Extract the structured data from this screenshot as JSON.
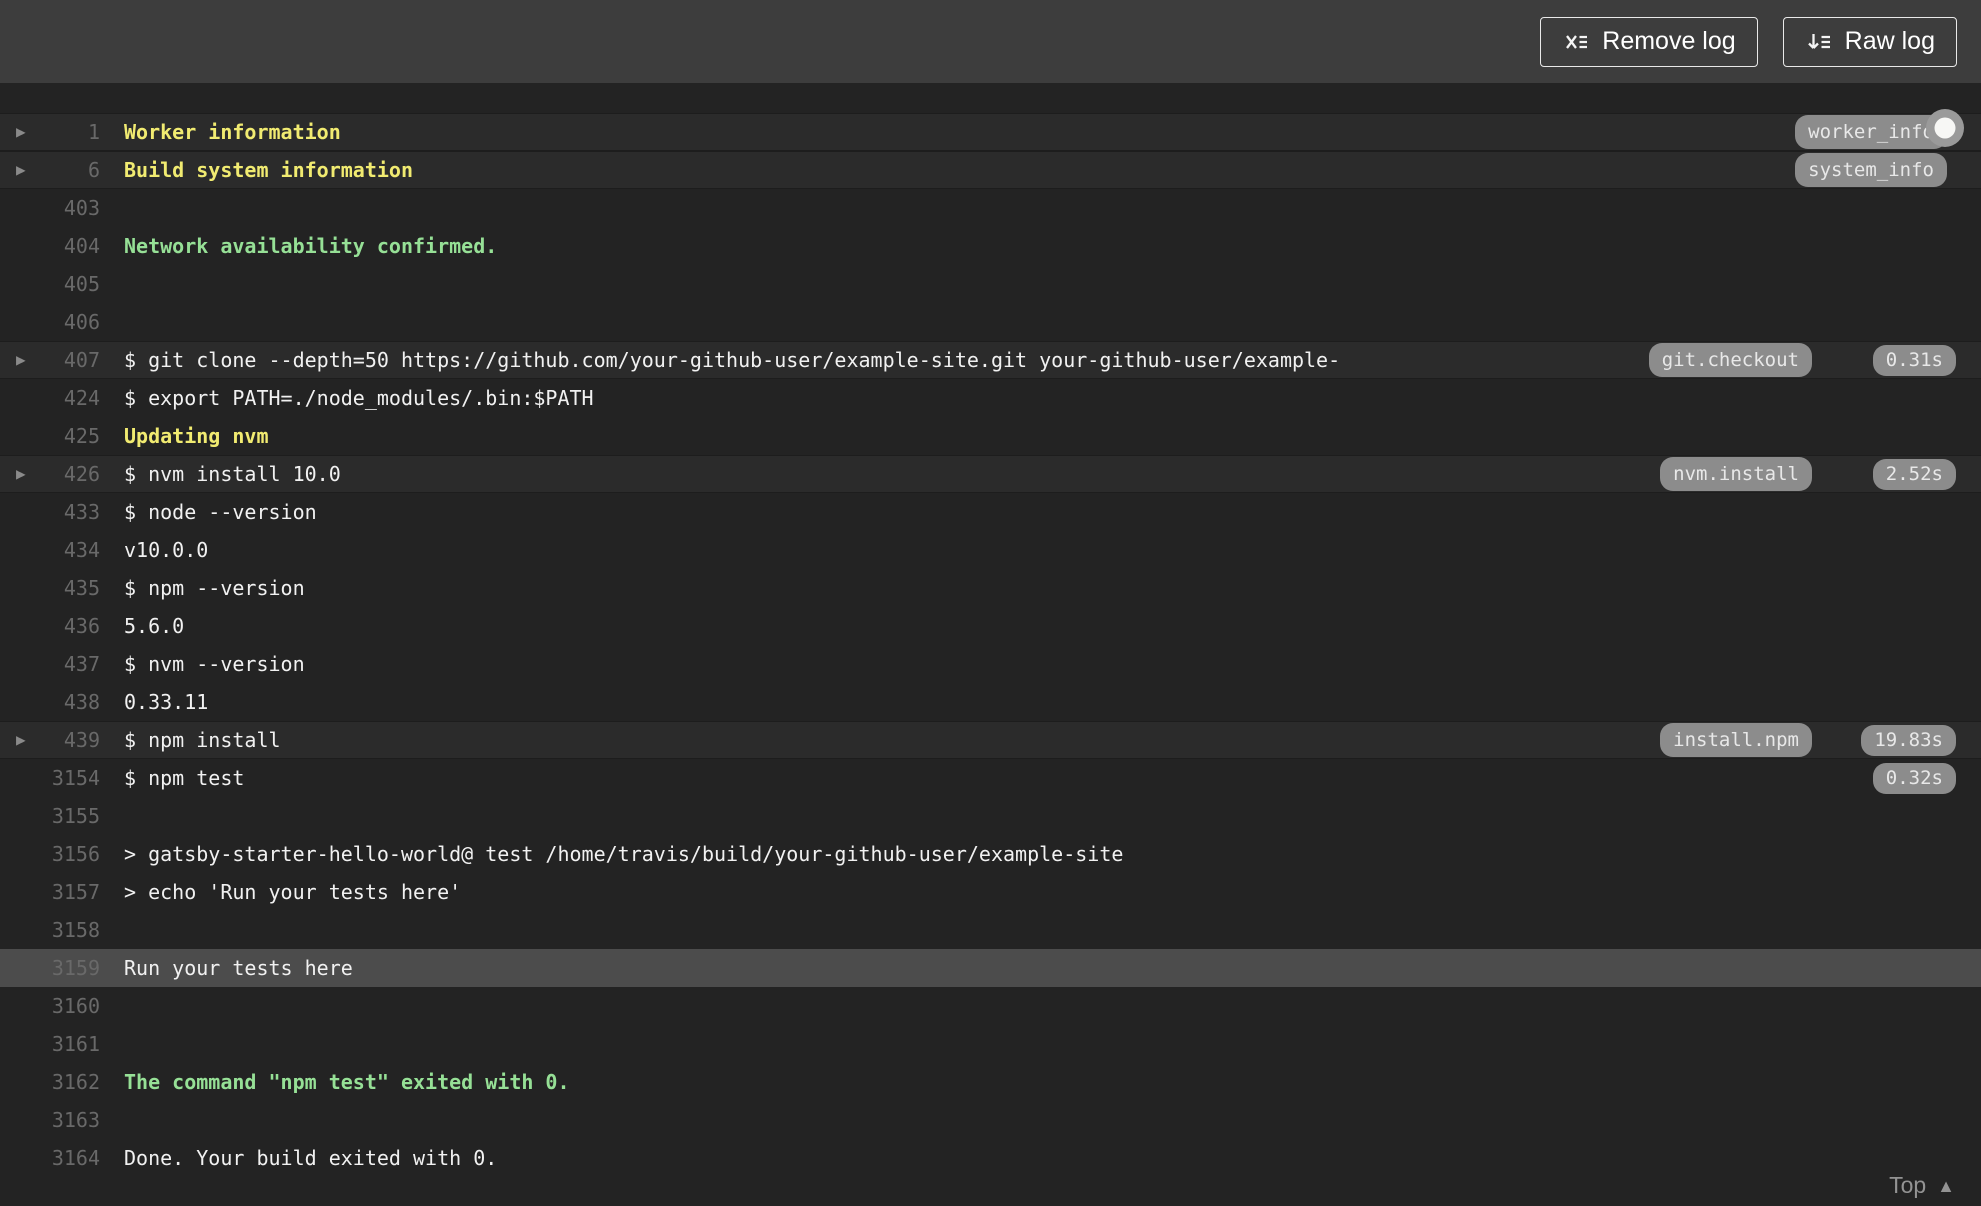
{
  "toolbar": {
    "remove_log_label": "Remove log",
    "raw_log_label": "Raw log"
  },
  "icons": {
    "fold": "▶",
    "top": "▲"
  },
  "colors": {
    "toolbar_bg": "#3d3d3d",
    "log_bg": "#232323",
    "fold_header_bg": "#2b2b2b",
    "selected_line_bg": "#4c4c4c",
    "text_default": "#f1f1f1",
    "text_yellow": "#f1eb71",
    "text_green": "#96e096",
    "line_number": "#696969",
    "badge_bg": "#8c8c8c"
  },
  "footer": {
    "top_label": "Top"
  },
  "log": {
    "lines": [
      {
        "number": "1",
        "text": "Worker information",
        "style": "yellow-bold",
        "fold": true,
        "header": true,
        "badge": "worker_info"
      },
      {
        "number": "6",
        "text": "Build system information",
        "style": "yellow-bold",
        "fold": true,
        "header": true,
        "badge": "system_info"
      },
      {
        "number": "403",
        "text": ""
      },
      {
        "number": "404",
        "text": "Network availability confirmed.",
        "style": "green-bold"
      },
      {
        "number": "405",
        "text": ""
      },
      {
        "number": "406",
        "text": ""
      },
      {
        "number": "407",
        "text": "$ git clone --depth=50 https://github.com/your-github-user/example-site.git your-github-user/example-",
        "fold": true,
        "header": true,
        "badge": "git.checkout",
        "duration": "0.31s"
      },
      {
        "number": "424",
        "text": "$ export PATH=./node_modules/.bin:$PATH"
      },
      {
        "number": "425",
        "text": "Updating nvm",
        "style": "yellow-bold"
      },
      {
        "number": "426",
        "text": "$ nvm install 10.0",
        "fold": true,
        "header": true,
        "badge": "nvm.install",
        "duration": "2.52s"
      },
      {
        "number": "433",
        "text": "$ node --version"
      },
      {
        "number": "434",
        "text": "v10.0.0"
      },
      {
        "number": "435",
        "text": "$ npm --version"
      },
      {
        "number": "436",
        "text": "5.6.0"
      },
      {
        "number": "437",
        "text": "$ nvm --version"
      },
      {
        "number": "438",
        "text": "0.33.11"
      },
      {
        "number": "439",
        "text": "$ npm install",
        "fold": true,
        "header": true,
        "badge": "install.npm",
        "duration": "19.83s"
      },
      {
        "number": "3154",
        "text": "$ npm test",
        "duration": "0.32s"
      },
      {
        "number": "3155",
        "text": ""
      },
      {
        "number": "3156",
        "text": "> gatsby-starter-hello-world@ test /home/travis/build/your-github-user/example-site"
      },
      {
        "number": "3157",
        "text": "> echo 'Run your tests here'"
      },
      {
        "number": "3158",
        "text": ""
      },
      {
        "number": "3159",
        "text": "Run your tests here",
        "selected": true
      },
      {
        "number": "3160",
        "text": ""
      },
      {
        "number": "3161",
        "text": ""
      },
      {
        "number": "3162",
        "text": "The command \"npm test\" exited with 0.",
        "style": "green-bold"
      },
      {
        "number": "3163",
        "text": ""
      },
      {
        "number": "3164",
        "text": "Done. Your build exited with 0."
      }
    ]
  }
}
